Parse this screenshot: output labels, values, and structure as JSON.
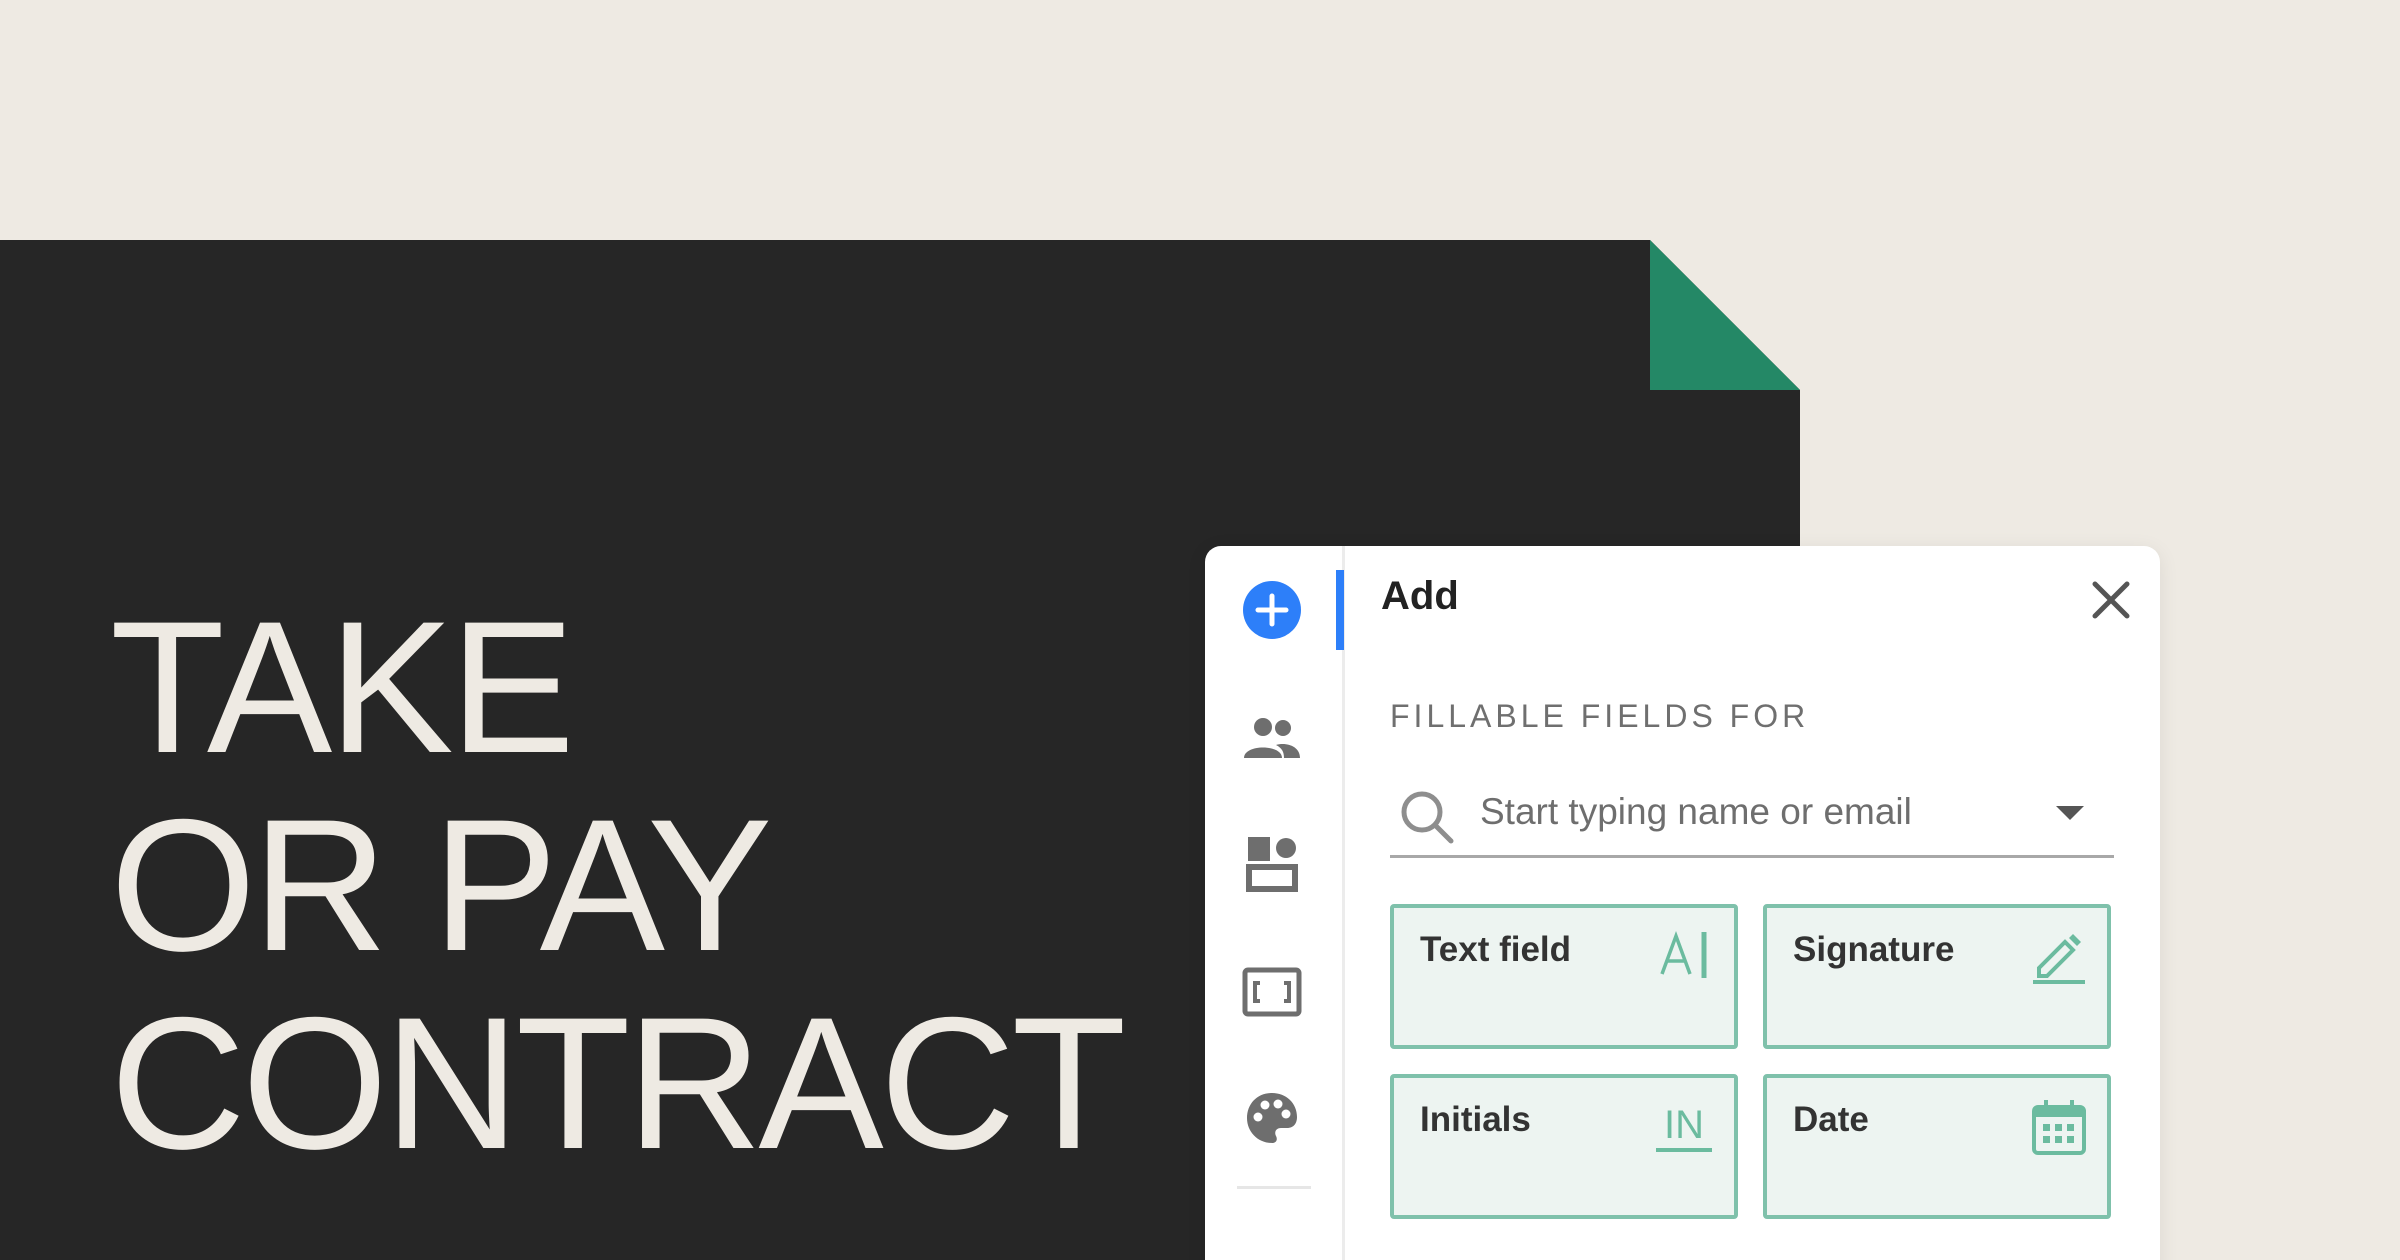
{
  "headline": {
    "line1": "TAKE",
    "line2": "OR PAY",
    "line3": "CONTRACT"
  },
  "panel": {
    "title": "Add",
    "section_label": "FILLABLE FIELDS FOR",
    "search": {
      "placeholder": "Start typing name or email",
      "value": ""
    },
    "fields": [
      {
        "label": "Text field",
        "icon": "text-field-icon"
      },
      {
        "label": "Signature",
        "icon": "pen-icon"
      },
      {
        "label": "Initials",
        "icon": "initials-icon",
        "icon_text": "IN"
      },
      {
        "label": "Date",
        "icon": "calendar-icon"
      }
    ],
    "sidebar": [
      {
        "icon": "add-icon",
        "active": true
      },
      {
        "icon": "people-icon"
      },
      {
        "icon": "blocks-icon"
      },
      {
        "icon": "frame-icon"
      },
      {
        "icon": "palette-icon"
      }
    ]
  },
  "colors": {
    "background": "#eeeae3",
    "document": "#262626",
    "fold": "#248866",
    "accent": "#2d7ff9",
    "field_border": "#7fc1ab",
    "field_fill": "#edf4f1"
  }
}
